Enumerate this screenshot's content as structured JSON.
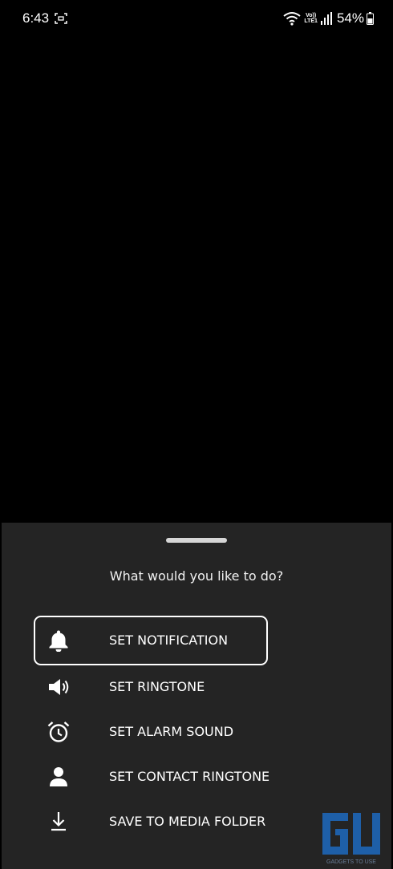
{
  "status_bar": {
    "time": "6:43",
    "volte_top": "Vo))",
    "volte_bottom": "LTE1",
    "battery": "54%"
  },
  "sheet": {
    "title": "What would you like to do?",
    "options": [
      {
        "label": "SET NOTIFICATION",
        "icon": "bell-icon",
        "focused": true
      },
      {
        "label": "SET RINGTONE",
        "icon": "speaker-icon",
        "focused": false
      },
      {
        "label": "SET ALARM SOUND",
        "icon": "alarm-clock-icon",
        "focused": false
      },
      {
        "label": "SET CONTACT RINGTONE",
        "icon": "person-icon",
        "focused": false
      },
      {
        "label": "SAVE TO MEDIA FOLDER",
        "icon": "download-icon",
        "focused": false
      }
    ]
  },
  "watermark": {
    "text": "GADGETS TO USE",
    "color": "#1e5fa8"
  },
  "colors": {
    "background": "#000000",
    "sheet": "#242424",
    "text": "#ffffff"
  }
}
